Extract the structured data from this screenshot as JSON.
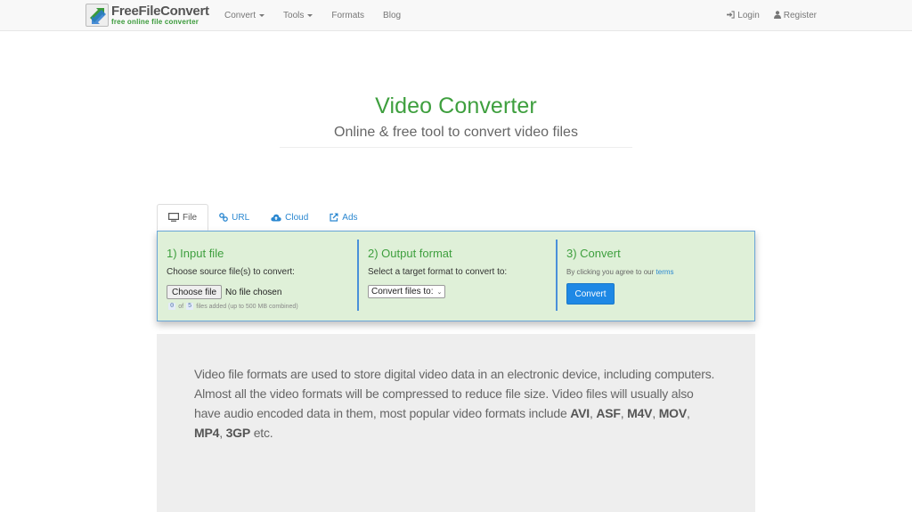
{
  "navbar": {
    "logo": {
      "title": "FreeFileConvert",
      "subtitle": "free online file converter"
    },
    "links": [
      {
        "label": "Convert",
        "dropdown": true
      },
      {
        "label": "Tools",
        "dropdown": true
      },
      {
        "label": "Formats",
        "dropdown": false
      },
      {
        "label": "Blog",
        "dropdown": false
      }
    ],
    "right": [
      {
        "label": "Login",
        "icon": "sign-in-icon"
      },
      {
        "label": "Register",
        "icon": "user-icon"
      }
    ]
  },
  "hero": {
    "title": "Video Converter",
    "subtitle": "Online & free tool to convert video files"
  },
  "tabs": [
    {
      "label": "File",
      "icon": "monitor-icon",
      "active": true
    },
    {
      "label": "URL",
      "icon": "link-icon",
      "active": false
    },
    {
      "label": "Cloud",
      "icon": "cloud-upload-icon",
      "active": false
    },
    {
      "label": "Ads",
      "icon": "external-link-icon",
      "active": false
    }
  ],
  "steps": {
    "input": {
      "heading": "1) Input file",
      "label": "Choose source file(s) to convert:",
      "button": "Choose file",
      "status": "No file chosen",
      "count_current": "0",
      "count_of": "of",
      "count_max": "5",
      "count_suffix": "files added (up to 500 MB combined)"
    },
    "output": {
      "heading": "2) Output format",
      "label": "Select a target format to convert to:",
      "select_value": "Convert files to:"
    },
    "convert": {
      "heading": "3) Convert",
      "agree_text": "By clicking you agree to our",
      "terms_link": "terms",
      "button": "Convert"
    }
  },
  "info": {
    "text_1": "Video file formats are used to store digital video data in an electronic device, including computers. Almost all the video formats will be compressed to reduce file size. Video files will usually also have audio encoded data in them, most popular video formats include ",
    "formats": [
      "AVI",
      "ASF",
      "M4V",
      "MOV",
      "MP4",
      "3GP"
    ],
    "text_end": " etc."
  },
  "colors": {
    "brand_green": "#3e9f3e",
    "link_blue": "#2a87d0",
    "panel_bg": "#dff0d8",
    "button_blue": "#1e88e5"
  }
}
